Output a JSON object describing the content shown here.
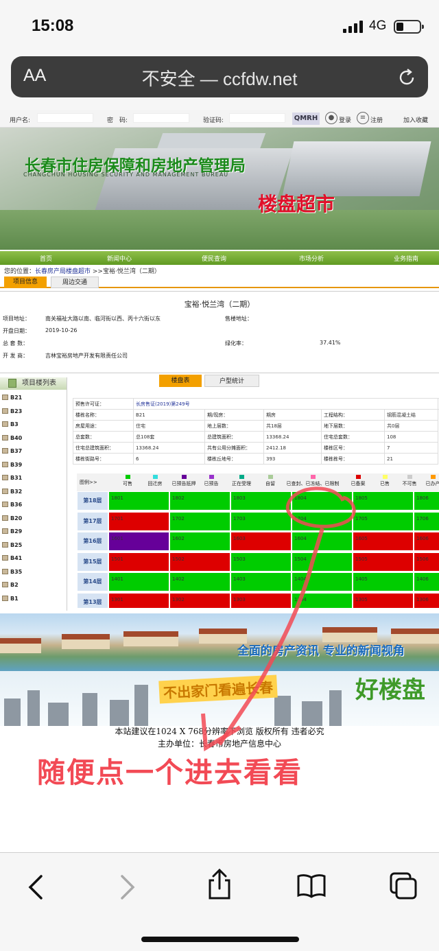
{
  "status_bar": {
    "time": "15:08",
    "network": "4G"
  },
  "address_bar": {
    "text_size": "AA",
    "url": "不安全 — ccfdw.net"
  },
  "login": {
    "username_label": "用户名:",
    "password_label": "密　码:",
    "captcha_label": "验证码:",
    "captcha_text": "QMRH",
    "login_link": "登录",
    "register_link": "注册",
    "favorite_link": "加入收藏"
  },
  "banner": {
    "title": "长春市住房保障和房地产管理局",
    "subtitle": "CHANGCHUN HOUSING SECURITY AND MANAGEMENT BUREAU",
    "slogan": "楼盘超市"
  },
  "nav": [
    "首页",
    "新闻中心",
    "便民查询",
    "市场分析",
    "业务指南"
  ],
  "breadcrumb": {
    "prefix": "您的位置：",
    "link": "长春房产局楼盘超市",
    "rest": " >>宝裕·悦兰湾（二期）"
  },
  "project_tabs": [
    "项目信息",
    "周边交通"
  ],
  "project": {
    "name": "宝裕·悦兰湾（二期）",
    "address_label": "项目地址：",
    "address": "南关福祉大路以南、临河街以西、丙十六街以东",
    "sales_address_label": "售楼地址：",
    "sales_address": "",
    "open_date_label": "开盘日期：",
    "open_date": "2019-10-26",
    "total_units_label": "总 套 数：",
    "total_units": "",
    "green_rate_label": "绿化率：",
    "green_rate": "37.41%",
    "developer_label": "开 发 商：",
    "developer": "吉林宝裕房地产开发有限责任公司"
  },
  "sidebar": {
    "title": "项目楼列表",
    "items": [
      "B21",
      "B23",
      "B3",
      "B40",
      "B37",
      "B39",
      "B31",
      "B32",
      "B36",
      "B20",
      "B29",
      "B25",
      "B41",
      "B35",
      "B2",
      "B1"
    ]
  },
  "building_tabs": [
    "楼盘表",
    "户型统计"
  ],
  "building_info": {
    "permit_label": "预售许可证：",
    "permit": "长房售证(2019)第249号",
    "building_name_label": "楼栋名称：",
    "building_name": "B21",
    "period_label": "期/现房：",
    "period": "期房",
    "structure_label": "工程结构：",
    "structure": "钢筋混凝土结",
    "usage_label": "房屋用途：",
    "usage": "住宅",
    "above_label": "地上层数：",
    "above": "共18层",
    "below_label": "地下层数：",
    "below": "共0层",
    "total_label": "总套数：",
    "total": "总108套",
    "total_area_label": "总建筑面积：",
    "total_area": "13368.24",
    "res_units_label": "住宅总套数：",
    "res_units": "108",
    "res_area_label": "住宅总建筑面积：",
    "res_area": "13368.24",
    "shared_label": "共有公用分摊面积：",
    "shared": "2412.18",
    "zone_label": "楼栋区号：",
    "zone": "7",
    "street_label": "楼栋街路号：",
    "street": "6",
    "hill_label": "楼栋丘地号：",
    "hill": "393",
    "bldg_no_label": "楼栋栋号：",
    "bldg_no": "21"
  },
  "legend": {
    "header": "图例>>",
    "items": [
      {
        "label": "可售",
        "color": "#00cc00"
      },
      {
        "label": "回迁房",
        "color": "#33dddd"
      },
      {
        "label": "已预告抵押",
        "color": "#660099"
      },
      {
        "label": "已预告",
        "color": "#9933cc"
      },
      {
        "label": "正在受理",
        "color": "#00aa88"
      },
      {
        "label": "自留",
        "color": "#aacc99"
      },
      {
        "label": "已查封、已冻结、已限制",
        "color": "#ff66aa"
      },
      {
        "label": "已备案",
        "color": "#dd0000"
      },
      {
        "label": "已售",
        "color": "#ffff66"
      },
      {
        "label": "不可售",
        "color": "#cccccc"
      },
      {
        "label": "已办产",
        "color": "#ff9900"
      }
    ]
  },
  "floors": [
    {
      "label": "第18层",
      "units": [
        [
          "1801",
          "g"
        ],
        [
          "1802",
          "g"
        ],
        [
          "1803",
          "g"
        ],
        [
          "1804",
          "g"
        ],
        [
          "1805",
          "g"
        ],
        [
          "1806",
          "g"
        ]
      ]
    },
    {
      "label": "第17层",
      "units": [
        [
          "1701",
          "r"
        ],
        [
          "1702",
          "g"
        ],
        [
          "1703",
          "g"
        ],
        [
          "1704",
          "g"
        ],
        [
          "1705",
          "g"
        ],
        [
          "1706",
          "g"
        ]
      ]
    },
    {
      "label": "第16层",
      "units": [
        [
          "1601",
          "p"
        ],
        [
          "1602",
          "g"
        ],
        [
          "1603",
          "r"
        ],
        [
          "1604",
          "g"
        ],
        [
          "1605",
          "r"
        ],
        [
          "1606",
          "r"
        ]
      ]
    },
    {
      "label": "第15层",
      "units": [
        [
          "1501",
          "r"
        ],
        [
          "1502",
          "r"
        ],
        [
          "1503",
          "g"
        ],
        [
          "1504",
          "g"
        ],
        [
          "1505",
          "r"
        ],
        [
          "1506",
          "r"
        ]
      ]
    },
    {
      "label": "第14层",
      "units": [
        [
          "1401",
          "g"
        ],
        [
          "1402",
          "g"
        ],
        [
          "1403",
          "g"
        ],
        [
          "1404",
          "g"
        ],
        [
          "1405",
          "g"
        ],
        [
          "1406",
          "g"
        ]
      ]
    },
    {
      "label": "第13层",
      "units": [
        [
          "1301",
          "r"
        ],
        [
          "1302",
          "r"
        ],
        [
          "1303",
          "r"
        ],
        [
          "1304",
          "g"
        ],
        [
          "1305",
          "r"
        ],
        [
          "1306",
          "r"
        ]
      ]
    }
  ],
  "ad1": {
    "text": "全面的房产资讯 专业的新闻视角"
  },
  "ad2": {
    "badge": "不出家门看遍长春",
    "big": "好楼盘"
  },
  "footer": {
    "line1": "本站建议在1024 X 768分辨率下浏览 版权所有 违者必究",
    "line2": "主办单位：长春市房地产信息中心"
  },
  "annotation": "随便点一个进去看看",
  "annotation_color": "#f24a55"
}
